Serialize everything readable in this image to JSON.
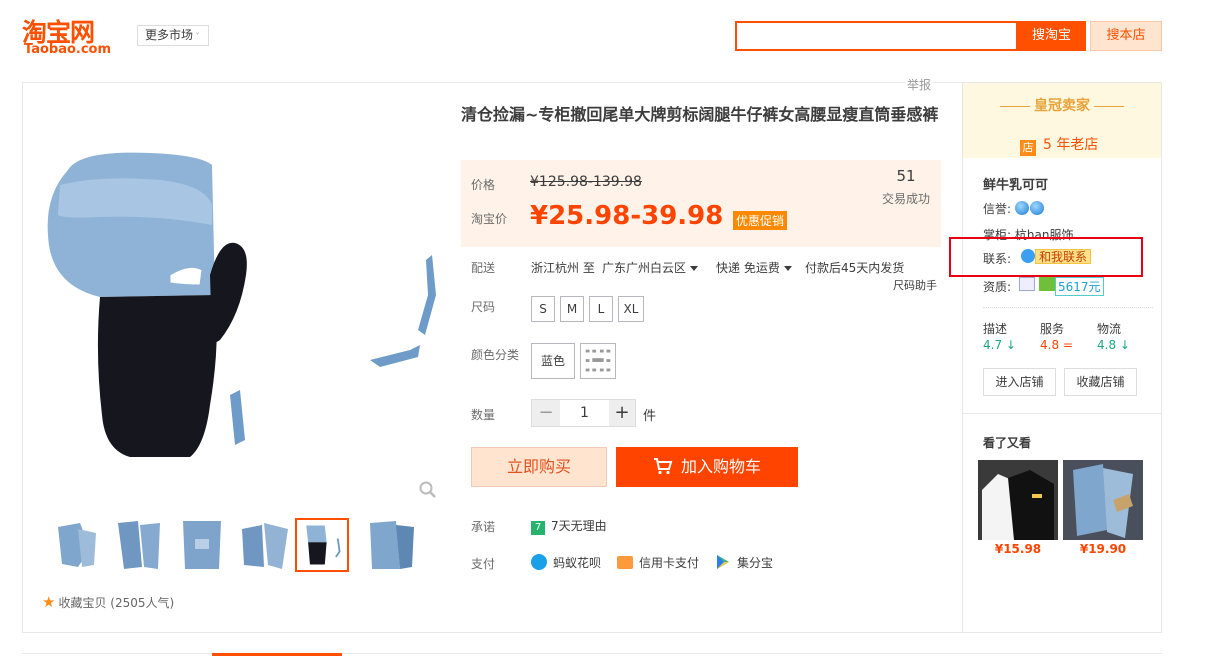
{
  "header": {
    "logo_cn": "淘宝网",
    "logo_en": "Taobao.com",
    "more_market": "更多市场",
    "search_placeholder": "",
    "search_taobao": "搜淘宝",
    "search_shop": "搜本店"
  },
  "gallery": {
    "report": "举报",
    "favorite": "收藏宝贝",
    "favorite_count": "(2505人气)",
    "thumbnail_count": 6,
    "active_thumbnail": 5
  },
  "product": {
    "title": "清仓捡漏~专柜撤回尾单大牌剪标阔腿牛仔裤女高腰显瘦直筒垂感裤",
    "price_label": "价格",
    "original_price": "¥125.98-139.98",
    "taobao_price_label": "淘宝价",
    "sale_price": "¥25.98-39.98",
    "promo_tag": "优惠促销",
    "sold_count": "51",
    "sold_label": "交易成功",
    "delivery_label": "配送",
    "delivery_from": "浙江杭州 至",
    "delivery_to": "广东广州白云区",
    "delivery_type": "快递 免运费",
    "delivery_time": "付款后45天内发货",
    "size_helper": "尺码助手",
    "size_label": "尺码",
    "sizes": [
      "S",
      "M",
      "L",
      "XL"
    ],
    "color_label": "颜色分类",
    "color_option": "蓝色",
    "quantity_label": "数量",
    "quantity": "1",
    "quantity_minus": "−",
    "quantity_plus": "+",
    "unit": "件",
    "buy_now": "立即购买",
    "add_cart": "加入购物车",
    "promise_label": "承诺",
    "promise_badge": "7",
    "promise_text": "7天无理由",
    "payment_label": "支付",
    "payments": [
      "蚂蚁花呗",
      "信用卡支付",
      "集分宝"
    ]
  },
  "seller": {
    "crown_title": "皇冠卖家",
    "shop_icon": "店",
    "years": "5 年老店",
    "name": "鲜牛乳可可",
    "credit_label": "信誉:",
    "keeper_label": "掌柜:",
    "keeper": "杭han服饰",
    "contact_label": "联系:",
    "contact_button": "和我联系",
    "cert_label": "资质:",
    "cert_number": "5617元",
    "scores": [
      {
        "label": "描述",
        "value": "4.7",
        "trend": "↓",
        "color": "#1ba784"
      },
      {
        "label": "服务",
        "value": "4.8",
        "trend": "=",
        "color": "#ff4400"
      },
      {
        "label": "物流",
        "value": "4.8",
        "trend": "↓",
        "color": "#1ba784"
      }
    ],
    "enter_shop": "进入店铺",
    "favorite_shop": "收藏店铺"
  },
  "also_viewed": {
    "title": "看了又看",
    "items": [
      {
        "price": "¥15.98"
      },
      {
        "price": "¥19.90"
      }
    ]
  },
  "colors": {
    "brand": "#ff5000",
    "price": "#ff4400",
    "highlight_box": "#e60012"
  }
}
